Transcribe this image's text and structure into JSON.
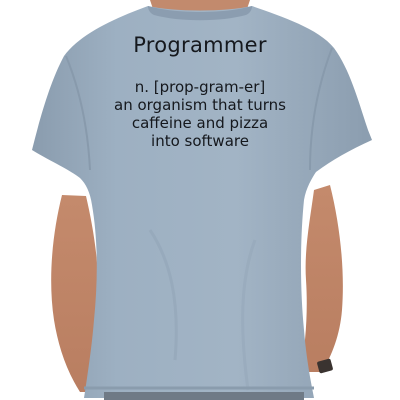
{
  "shirt": {
    "color": "#98aabb",
    "skin_color": "#c98f72",
    "print": {
      "title": "Programmer",
      "lines": [
        "n. [prop-gram-er]",
        "an organism that turns",
        "caffeine and pizza",
        "into software"
      ],
      "text_color": "#15181d"
    }
  }
}
